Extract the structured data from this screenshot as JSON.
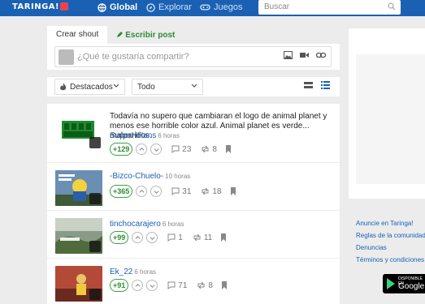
{
  "topbar": {
    "logo": "TARINGA!",
    "nav": {
      "global": "Global",
      "explorar": "Explorar",
      "juegos": "Juegos"
    },
    "search_placeholder": "Buscar"
  },
  "composer": {
    "tab_active": "Crear shout",
    "tab_write": "Escribir post",
    "placeholder": "¿Qué te gustaría compartir?"
  },
  "filters": {
    "sort": "Destacados",
    "scope": "Todo"
  },
  "posts": [
    {
      "text": "Todavía no supero que cambiaran el logo de animal planet y menos ese horrible color azul. Animal planet es verde... malparidos.",
      "author": "SuperHHans",
      "time": "6 horas",
      "score": "+129",
      "comments": "23",
      "reshares": "8",
      "thumb_text": "ANIMAL PLANET"
    },
    {
      "text": "",
      "author": "-Bizco-Chuelo-",
      "time": "10 horas",
      "score": "+365",
      "comments": "31",
      "reshares": "18"
    },
    {
      "text": "",
      "author": "tinchocarajero",
      "time": "6 horas",
      "score": "+99",
      "comments": "1",
      "reshares": "11"
    },
    {
      "text": "",
      "author": "Ek_22",
      "time": "6 horas",
      "score": "+91",
      "comments": "71",
      "reshares": "8"
    }
  ],
  "footer_links": [
    "Anuncie en Taringa!",
    "Reglas de la comunidad",
    "Denuncias",
    "Términos y condiciones"
  ],
  "gplay": {
    "line1": "DISPONIBLE EN",
    "line2": "Google"
  },
  "colors": {
    "brand_blue": "#1a61b3",
    "score_green": "#3aa341",
    "write_green": "#2e8b33"
  }
}
